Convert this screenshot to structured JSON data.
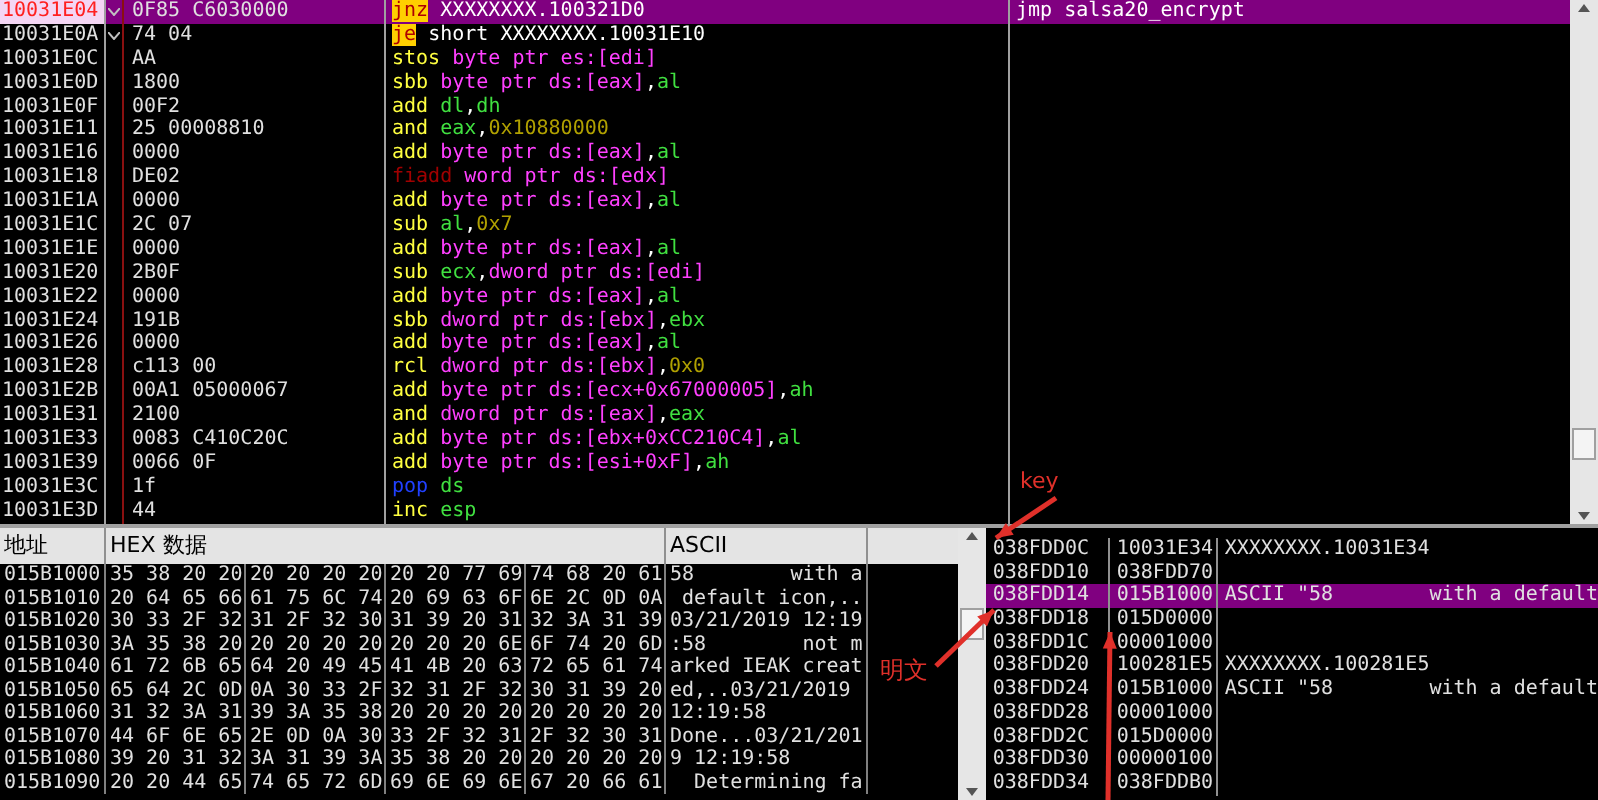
{
  "code": {
    "rows": [
      {
        "address": "10031E04",
        "bytes": "0F85 C6030000",
        "jump_mark": true,
        "selected": true,
        "mnemonic": "jnz",
        "kind": "jump",
        "operands": [
          {
            "text": "XXXXXXXX.100321D0",
            "kind": "sym"
          }
        ],
        "comment": "jmp salsa20_encrypt"
      },
      {
        "address": "10031E0A",
        "bytes": "74 04",
        "jump_mark": true,
        "selected": false,
        "mnemonic": "je",
        "kind": "jump",
        "operands": [
          {
            "text": "short XXXXXXXX.10031E10",
            "kind": "sym"
          }
        ]
      },
      {
        "address": "10031E0C",
        "bytes": "AA",
        "jump_mark": false,
        "selected": false,
        "mnemonic": "stos",
        "kind": "normal",
        "operands": [
          {
            "text": "byte ptr es:[edi]",
            "kind": "mem"
          }
        ]
      },
      {
        "address": "10031E0D",
        "bytes": "1800",
        "jump_mark": false,
        "selected": false,
        "mnemonic": "sbb",
        "kind": "normal",
        "operands": [
          {
            "text": "byte ptr ds:[eax]",
            "kind": "mem"
          },
          {
            "text": ",",
            "kind": "punct"
          },
          {
            "text": "al",
            "kind": "reg"
          }
        ]
      },
      {
        "address": "10031E0F",
        "bytes": "00F2",
        "jump_mark": false,
        "selected": false,
        "mnemonic": "add",
        "kind": "normal",
        "operands": [
          {
            "text": "dl",
            "kind": "reg"
          },
          {
            "text": ",",
            "kind": "punct"
          },
          {
            "text": "dh",
            "kind": "reg"
          }
        ]
      },
      {
        "address": "10031E11",
        "bytes": "25 00008810",
        "jump_mark": false,
        "selected": false,
        "mnemonic": "and",
        "kind": "normal",
        "operands": [
          {
            "text": "eax",
            "kind": "reg"
          },
          {
            "text": ",",
            "kind": "punct"
          },
          {
            "text": "0x10880000",
            "kind": "imm"
          }
        ]
      },
      {
        "address": "10031E16",
        "bytes": "0000",
        "jump_mark": false,
        "selected": false,
        "mnemonic": "add",
        "kind": "normal",
        "operands": [
          {
            "text": "byte ptr ds:[eax]",
            "kind": "mem"
          },
          {
            "text": ",",
            "kind": "punct"
          },
          {
            "text": "al",
            "kind": "reg"
          }
        ]
      },
      {
        "address": "10031E18",
        "bytes": "DE02",
        "jump_mark": false,
        "selected": false,
        "mnemonic": "fiadd",
        "kind": "fpu",
        "operands": [
          {
            "text": "word ptr ds:[edx]",
            "kind": "mem"
          }
        ]
      },
      {
        "address": "10031E1A",
        "bytes": "0000",
        "jump_mark": false,
        "selected": false,
        "mnemonic": "add",
        "kind": "normal",
        "operands": [
          {
            "text": "byte ptr ds:[eax]",
            "kind": "mem"
          },
          {
            "text": ",",
            "kind": "punct"
          },
          {
            "text": "al",
            "kind": "reg"
          }
        ]
      },
      {
        "address": "10031E1C",
        "bytes": "2C 07",
        "jump_mark": false,
        "selected": false,
        "mnemonic": "sub",
        "kind": "normal",
        "operands": [
          {
            "text": "al",
            "kind": "reg"
          },
          {
            "text": ",",
            "kind": "punct"
          },
          {
            "text": "0x7",
            "kind": "imm"
          }
        ]
      },
      {
        "address": "10031E1E",
        "bytes": "0000",
        "jump_mark": false,
        "selected": false,
        "mnemonic": "add",
        "kind": "normal",
        "operands": [
          {
            "text": "byte ptr ds:[eax]",
            "kind": "mem"
          },
          {
            "text": ",",
            "kind": "punct"
          },
          {
            "text": "al",
            "kind": "reg"
          }
        ]
      },
      {
        "address": "10031E20",
        "bytes": "2B0F",
        "jump_mark": false,
        "selected": false,
        "mnemonic": "sub",
        "kind": "normal",
        "operands": [
          {
            "text": "ecx",
            "kind": "reg"
          },
          {
            "text": ",",
            "kind": "punct"
          },
          {
            "text": "dword ptr ds:[edi]",
            "kind": "mem"
          }
        ]
      },
      {
        "address": "10031E22",
        "bytes": "0000",
        "jump_mark": false,
        "selected": false,
        "mnemonic": "add",
        "kind": "normal",
        "operands": [
          {
            "text": "byte ptr ds:[eax]",
            "kind": "mem"
          },
          {
            "text": ",",
            "kind": "punct"
          },
          {
            "text": "al",
            "kind": "reg"
          }
        ]
      },
      {
        "address": "10031E24",
        "bytes": "191B",
        "jump_mark": false,
        "selected": false,
        "mnemonic": "sbb",
        "kind": "normal",
        "operands": [
          {
            "text": "dword ptr ds:[ebx]",
            "kind": "mem"
          },
          {
            "text": ",",
            "kind": "punct"
          },
          {
            "text": "ebx",
            "kind": "reg"
          }
        ]
      },
      {
        "address": "10031E26",
        "bytes": "0000",
        "jump_mark": false,
        "selected": false,
        "mnemonic": "add",
        "kind": "normal",
        "operands": [
          {
            "text": "byte ptr ds:[eax]",
            "kind": "mem"
          },
          {
            "text": ",",
            "kind": "punct"
          },
          {
            "text": "al",
            "kind": "reg"
          }
        ]
      },
      {
        "address": "10031E28",
        "bytes": "c113 00",
        "jump_mark": false,
        "selected": false,
        "mnemonic": "rcl",
        "kind": "normal",
        "operands": [
          {
            "text": "dword ptr ds:[ebx]",
            "kind": "mem"
          },
          {
            "text": ",",
            "kind": "punct"
          },
          {
            "text": "0x0",
            "kind": "imm"
          }
        ]
      },
      {
        "address": "10031E2B",
        "bytes": "00A1 05000067",
        "jump_mark": false,
        "selected": false,
        "mnemonic": "add",
        "kind": "normal",
        "operands": [
          {
            "text": "byte ptr ds:[ecx+0x67000005]",
            "kind": "mem"
          },
          {
            "text": ",",
            "kind": "punct"
          },
          {
            "text": "ah",
            "kind": "reg"
          }
        ]
      },
      {
        "address": "10031E31",
        "bytes": "2100",
        "jump_mark": false,
        "selected": false,
        "mnemonic": "and",
        "kind": "normal",
        "operands": [
          {
            "text": "dword ptr ds:[eax]",
            "kind": "mem"
          },
          {
            "text": ",",
            "kind": "punct"
          },
          {
            "text": "eax",
            "kind": "reg"
          }
        ]
      },
      {
        "address": "10031E33",
        "bytes": "0083 C410C20C",
        "jump_mark": false,
        "selected": false,
        "mnemonic": "add",
        "kind": "normal",
        "operands": [
          {
            "text": "byte ptr ds:[ebx+0xCC210C4]",
            "kind": "mem"
          },
          {
            "text": ",",
            "kind": "punct"
          },
          {
            "text": "al",
            "kind": "reg"
          }
        ]
      },
      {
        "address": "10031E39",
        "bytes": "0066 0F",
        "jump_mark": false,
        "selected": false,
        "mnemonic": "add",
        "kind": "normal",
        "operands": [
          {
            "text": "byte ptr ds:[esi+0xF]",
            "kind": "mem"
          },
          {
            "text": ",",
            "kind": "punct"
          },
          {
            "text": "ah",
            "kind": "reg"
          }
        ]
      },
      {
        "address": "10031E3C",
        "bytes": "1f",
        "jump_mark": false,
        "selected": false,
        "mnemonic": "pop",
        "kind": "stack",
        "operands": [
          {
            "text": "ds",
            "kind": "reg"
          }
        ]
      },
      {
        "address": "10031E3D",
        "bytes": "44",
        "jump_mark": false,
        "selected": false,
        "mnemonic": "inc",
        "kind": "normal",
        "operands": [
          {
            "text": "esp",
            "kind": "reg"
          }
        ]
      }
    ]
  },
  "dump": {
    "columns": [
      "地址",
      "HEX 数据",
      "ASCII"
    ],
    "rows": [
      {
        "address": "015B1000",
        "bytes": [
          "35 38 20 20",
          "20 20 20 20",
          "20 20 77 69",
          "74 68 20 61"
        ],
        "ascii": "58        with a"
      },
      {
        "address": "015B1010",
        "bytes": [
          "20 64 65 66",
          "61 75 6C 74",
          "20 69 63 6F",
          "6E 2C 0D 0A"
        ],
        "ascii": " default icon,.."
      },
      {
        "address": "015B1020",
        "bytes": [
          "30 33 2F 32",
          "31 2F 32 30",
          "31 39 20 31",
          "32 3A 31 39"
        ],
        "ascii": "03/21/2019 12:19"
      },
      {
        "address": "015B1030",
        "bytes": [
          "3A 35 38 20",
          "20 20 20 20",
          "20 20 20 6E",
          "6F 74 20 6D"
        ],
        "ascii": ":58        not m"
      },
      {
        "address": "015B1040",
        "bytes": [
          "61 72 6B 65",
          "64 20 49 45",
          "41 4B 20 63",
          "72 65 61 74"
        ],
        "ascii": "arked IEAK creat"
      },
      {
        "address": "015B1050",
        "bytes": [
          "65 64 2C 0D",
          "0A 30 33 2F",
          "32 31 2F 32",
          "30 31 39 20"
        ],
        "ascii": "ed,..03/21/2019"
      },
      {
        "address": "015B1060",
        "bytes": [
          "31 32 3A 31",
          "39 3A 35 38",
          "20 20 20 20",
          "20 20 20 20"
        ],
        "ascii": "12:19:58"
      },
      {
        "address": "015B1070",
        "bytes": [
          "44 6F 6E 65",
          "2E 0D 0A 30",
          "33 2F 32 31",
          "2F 32 30 31"
        ],
        "ascii": "Done...03/21/201"
      },
      {
        "address": "015B1080",
        "bytes": [
          "39 20 31 32",
          "3A 31 39 3A",
          "35 38 20 20",
          "20 20 20 20"
        ],
        "ascii": "9 12:19:58"
      },
      {
        "address": "015B1090",
        "bytes": [
          "20 20 44 65",
          "74 65 72 6D",
          "69 6E 69 6E",
          "67 20 66 61"
        ],
        "ascii": "  Determining fa"
      }
    ]
  },
  "stack": {
    "rows": [
      {
        "address": "038FDD0C",
        "value": "10031E34",
        "comment": "XXXXXXXX.10031E34",
        "selected": false
      },
      {
        "address": "038FDD10",
        "value": "038FDD70",
        "selected": false
      },
      {
        "address": "038FDD14",
        "value": "015B1000",
        "comment": "ASCII \"58        with a default",
        "selected": true
      },
      {
        "address": "038FDD18",
        "value": "015D0000",
        "selected": false
      },
      {
        "address": "038FDD1C",
        "value": "00001000",
        "selected": false
      },
      {
        "address": "038FDD20",
        "value": "100281E5",
        "comment": "XXXXXXXX.100281E5",
        "selected": false
      },
      {
        "address": "038FDD24",
        "value": "015B1000",
        "comment": "ASCII \"58        with a default",
        "selected": false
      },
      {
        "address": "038FDD28",
        "value": "00001000",
        "selected": false
      },
      {
        "address": "038FDD2C",
        "value": "015D0000",
        "selected": false
      },
      {
        "address": "038FDD30",
        "value": "00000100",
        "selected": false
      },
      {
        "address": "038FDD34",
        "value": "038FDDB0",
        "selected": false
      }
    ]
  },
  "annotations": [
    {
      "text": "key"
    },
    {
      "text": "明文"
    }
  ]
}
